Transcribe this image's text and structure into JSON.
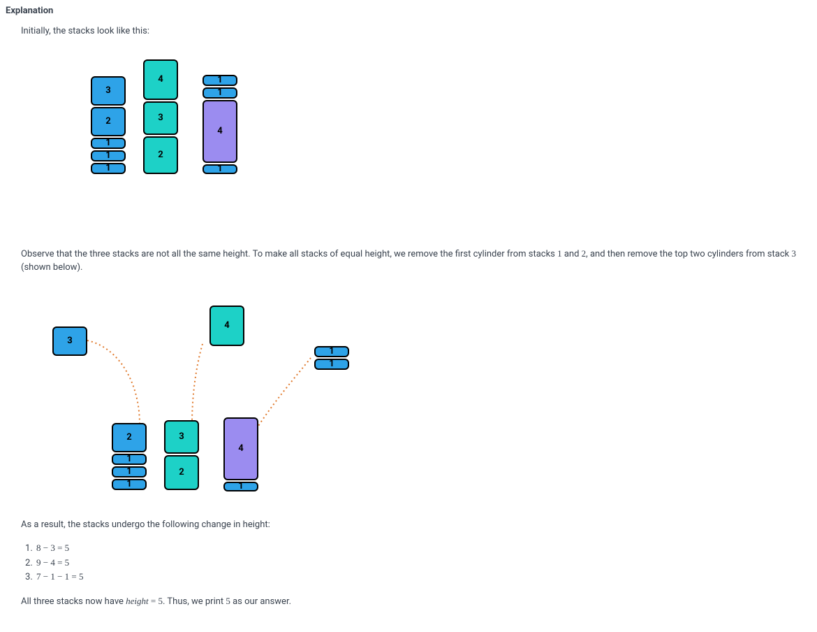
{
  "heading": "Explanation",
  "intro": "Initially, the stacks look like this:",
  "diagram1": {
    "stack1": [
      "3",
      "2",
      "1",
      "1",
      "1"
    ],
    "stack2": [
      "4",
      "3",
      "2"
    ],
    "stack3": [
      "1",
      "1",
      "4",
      "1"
    ]
  },
  "observe_prefix": "Observe that the three stacks are not all the same height. To make all stacks of equal height, we remove the first cylinder from stacks ",
  "observe_n1": "1",
  "observe_mid1": " and ",
  "observe_n2": "2",
  "observe_mid2": ", and then remove the top two cylinders from stack ",
  "observe_n3": "3",
  "observe_suffix": " (shown below).",
  "diagram2": {
    "removed_s1": "3",
    "removed_s2_top": "4",
    "removed_s3_a": "1",
    "removed_s3_b": "1",
    "stack1": [
      "2",
      "1",
      "1",
      "1"
    ],
    "stack2": [
      "3",
      "2"
    ],
    "stack3": [
      "4",
      "1"
    ]
  },
  "result_lead": "As a result, the stacks undergo the following change in height:",
  "calc": {
    "l1": "8 − 3 = 5",
    "l2": "9 − 4 = 5",
    "l3": "7 − 1 − 1 = 5"
  },
  "final_prefix": "All three stacks now have ",
  "final_word": "height",
  "final_eq": " = ",
  "final_val": "5",
  "final_mid": ". Thus, we print ",
  "final_ans": "5",
  "final_suffix": " as our answer."
}
